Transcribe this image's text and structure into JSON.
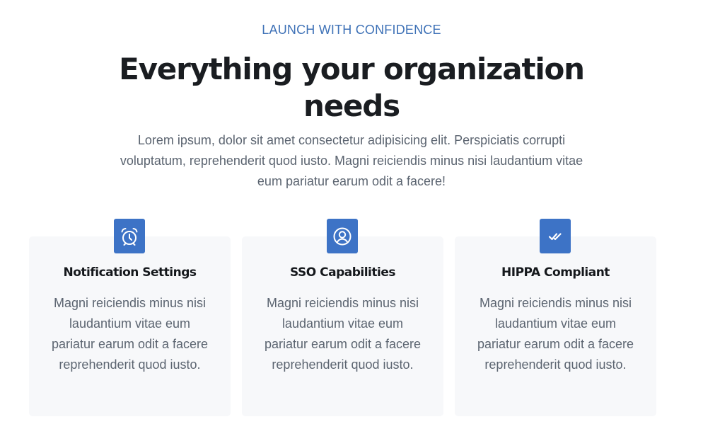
{
  "hero": {
    "eyebrow": "LAUNCH WITH CONFIDENCE",
    "title": "Everything your organization needs",
    "lead": "Lorem ipsum, dolor sit amet consectetur adipisicing elit. Perspiciatis corrupti voluptatum, reprehenderit quod iusto. Magni reiciendis minus nisi laudantium vitae eum pariatur earum odit a facere!"
  },
  "features": [
    {
      "icon": "alarm-clock-icon",
      "title": "Notification Settings",
      "text": "Magni reiciendis minus nisi laudantium vitae eum pariatur earum odit a facere reprehenderit quod iusto."
    },
    {
      "icon": "user-circle-icon",
      "title": "SSO Capabilities",
      "text": "Magni reiciendis minus nisi laudantium vitae eum pariatur earum odit a facere reprehenderit quod iusto."
    },
    {
      "icon": "double-check-icon",
      "title": "HIPPA Compliant",
      "text": "Magni reiciendis minus nisi laudantium vitae eum pariatur earum odit a facere reprehenderit quod iusto."
    }
  ],
  "colors": {
    "accent": "#3d73c6",
    "eyebrow": "#3f72b7",
    "heading": "#1a1d21",
    "body_text": "#5b6470",
    "card_background": "#f7f8fa"
  }
}
